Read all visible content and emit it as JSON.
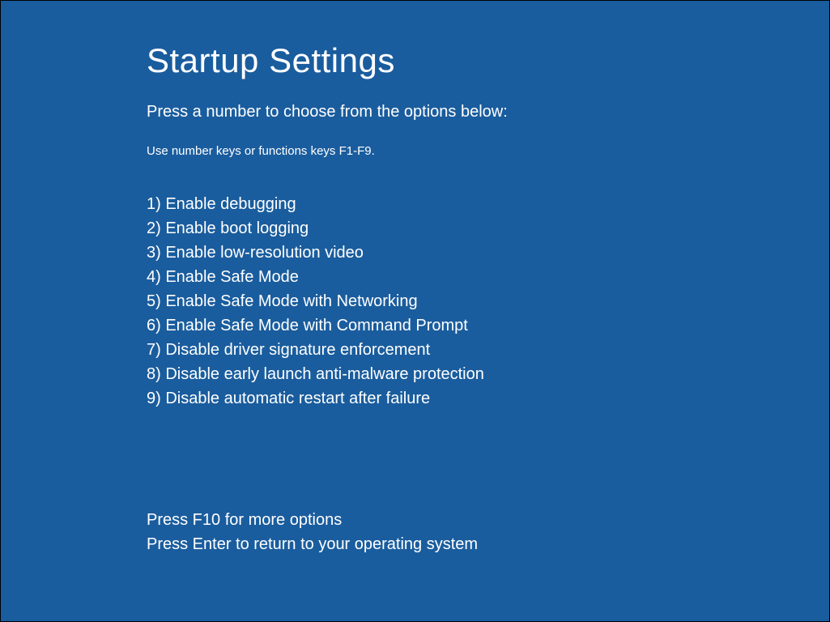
{
  "title": "Startup Settings",
  "instruction": "Press a number to choose from the options below:",
  "hint": "Use number keys or functions keys F1-F9.",
  "options": [
    "1) Enable debugging",
    "2) Enable boot logging",
    "3) Enable low-resolution video",
    "4) Enable Safe Mode",
    "5) Enable Safe Mode with Networking",
    "6) Enable Safe Mode with Command Prompt",
    "7) Disable driver signature enforcement",
    "8) Disable early launch anti-malware protection",
    "9) Disable automatic restart after failure"
  ],
  "footer_more": "Press F10 for more options",
  "footer_return": "Press Enter to return to your operating system"
}
